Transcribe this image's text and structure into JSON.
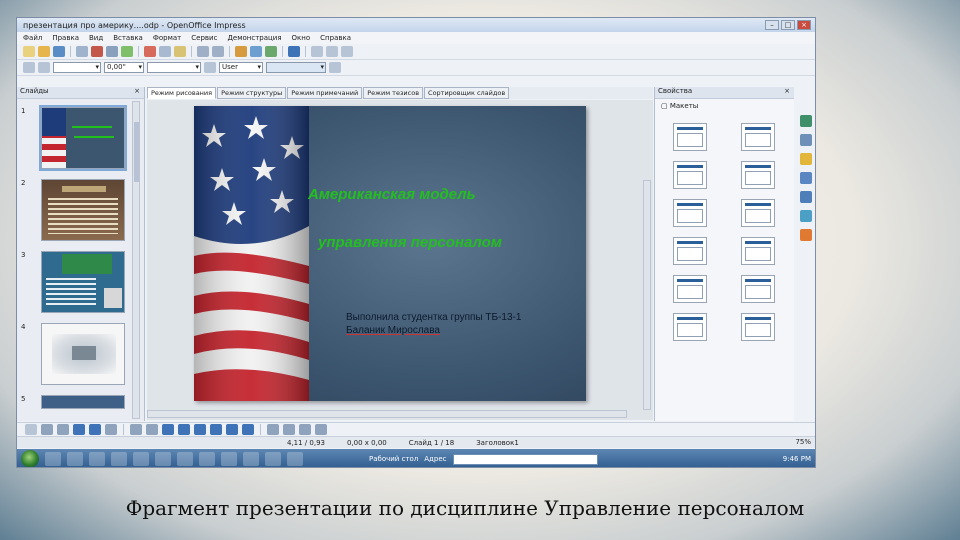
{
  "caption": "Фрагмент презентации по дисциплине Управление персоналом",
  "window": {
    "title": "презентация про америку....оdp - OpenOffice Impress"
  },
  "menu": [
    "Файл",
    "Правка",
    "Вид",
    "Вставка",
    "Формат",
    "Сервис",
    "Демонстрация",
    "Окно",
    "Справка"
  ],
  "format_bar": {
    "line_width": "0,00\"",
    "color_value": "User"
  },
  "slides_panel": {
    "header": "Слайды",
    "close": "×",
    "numbers": [
      "1",
      "2",
      "3",
      "4",
      "5"
    ]
  },
  "tabs": [
    {
      "label": "Режим рисования",
      "active": true
    },
    {
      "label": "Режим структуры",
      "active": false
    },
    {
      "label": "Режим примечаний",
      "active": false
    },
    {
      "label": "Режим тезисов",
      "active": false
    },
    {
      "label": "Сортировщик слайдов",
      "active": false
    }
  ],
  "slide": {
    "title_line1": "Американская модель",
    "title_line2": "управления персоналом",
    "author_line1": "Выполнила студентка группы ТБ-13-1",
    "author_line2": "Баланик Мирослава"
  },
  "properties_panel": {
    "header": "Свойства",
    "close": "×",
    "section": "Макеты"
  },
  "status": {
    "position": "4,11 / 0,93",
    "size": "0,00 x 0,00",
    "slide_info": "Слайд 1 / 18",
    "master": "Заголовок1",
    "zoom": "75%"
  },
  "taskbar": {
    "desktop_label": "Рабочий стол",
    "address_label": "Адрес",
    "clock": "9:46 PM"
  },
  "colors": {
    "title_green": "#22c01e",
    "accent_blue": "#2b5f9a"
  }
}
